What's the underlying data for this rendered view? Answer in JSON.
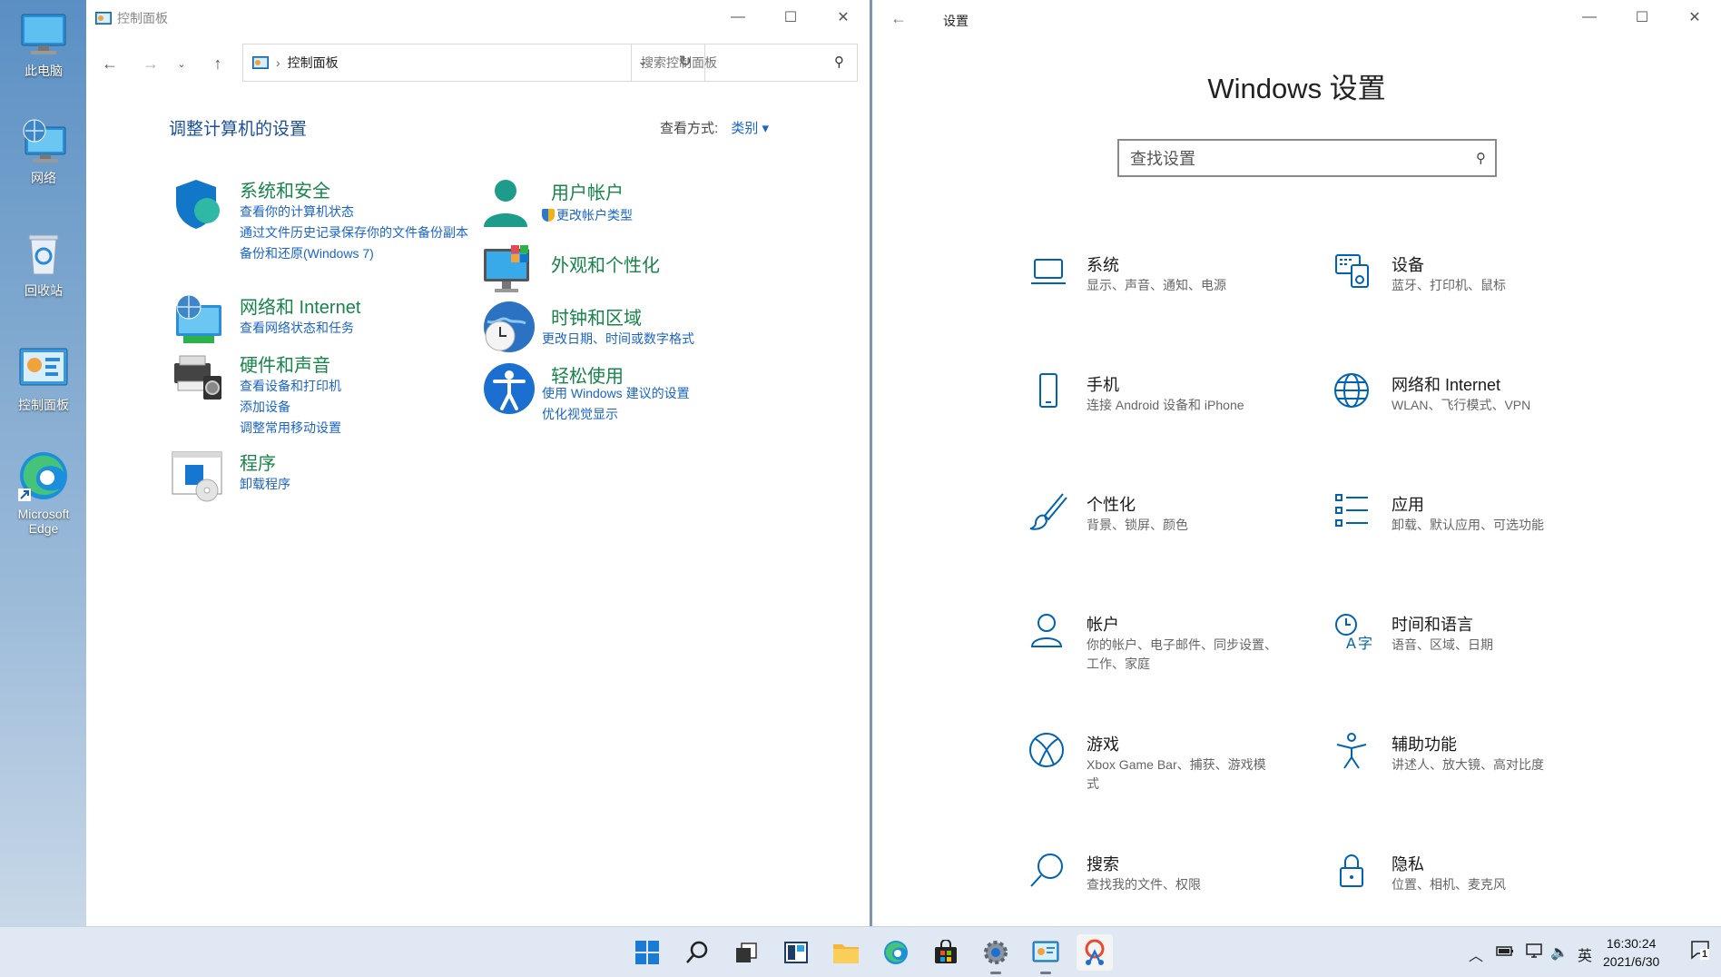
{
  "desktop": {
    "icons": [
      {
        "label": "此电脑"
      },
      {
        "label": "网络"
      },
      {
        "label": "回收站"
      },
      {
        "label": "控制面板"
      },
      {
        "label": "Microsoft Edge"
      }
    ]
  },
  "control_panel": {
    "window_title": "控制面板",
    "address": "控制面板",
    "search_placeholder": "搜索控制面板",
    "heading": "调整计算机的设置",
    "view_by_label": "查看方式:",
    "view_by_value": "类别 ▾",
    "categories": [
      {
        "title": "系统和安全",
        "links": [
          "查看你的计算机状态",
          "通过文件历史记录保存你的文件备份副本",
          "备份和还原(Windows 7)"
        ],
        "icon": "shield-icon"
      },
      {
        "title": "网络和 Internet",
        "links": [
          "查看网络状态和任务"
        ],
        "icon": "network-globe-icon"
      },
      {
        "title": "硬件和声音",
        "links": [
          "查看设备和打印机",
          "添加设备",
          "调整常用移动设置"
        ],
        "icon": "printer-icon"
      },
      {
        "title": "程序",
        "links": [
          "卸载程序"
        ],
        "icon": "programs-icon"
      },
      {
        "title": "用户帐户",
        "links": [
          "更改帐户类型"
        ],
        "icon": "user-icon"
      },
      {
        "title": "外观和个性化",
        "links": [],
        "icon": "monitor-color-icon"
      },
      {
        "title": "时钟和区域",
        "links": [
          "更改日期、时间或数字格式"
        ],
        "icon": "clock-globe-icon"
      },
      {
        "title": "轻松使用",
        "links": [
          "使用 Windows 建议的设置",
          "优化视觉显示"
        ],
        "icon": "accessibility-icon"
      }
    ]
  },
  "settings": {
    "window_title": "设置",
    "heading": "Windows 设置",
    "search_placeholder": "查找设置",
    "tiles": [
      {
        "title": "系统",
        "desc": "显示、声音、通知、电源",
        "icon": "laptop-icon"
      },
      {
        "title": "设备",
        "desc": "蓝牙、打印机、鼠标",
        "icon": "keyboard-speaker-icon"
      },
      {
        "title": "手机",
        "desc": "连接 Android 设备和 iPhone",
        "icon": "phone-icon"
      },
      {
        "title": "网络和 Internet",
        "desc": "WLAN、飞行模式、VPN",
        "icon": "globe-icon"
      },
      {
        "title": "个性化",
        "desc": "背景、锁屏、颜色",
        "icon": "brush-icon"
      },
      {
        "title": "应用",
        "desc": "卸载、默认应用、可选功能",
        "icon": "apps-list-icon"
      },
      {
        "title": "帐户",
        "desc": "你的帐户、电子邮件、同步设置、工作、家庭",
        "icon": "person-icon"
      },
      {
        "title": "时间和语言",
        "desc": "语音、区域、日期",
        "icon": "time-language-icon"
      },
      {
        "title": "游戏",
        "desc": "Xbox Game Bar、捕获、游戏模式",
        "icon": "xbox-icon"
      },
      {
        "title": "辅助功能",
        "desc": "讲述人、放大镜、高对比度",
        "icon": "accessibility-person-icon"
      },
      {
        "title": "搜索",
        "desc": "查找我的文件、权限",
        "icon": "search-icon"
      },
      {
        "title": "隐私",
        "desc": "位置、相机、麦克风",
        "icon": "lock-icon"
      }
    ]
  },
  "taskbar": {
    "ime": "英",
    "time": "16:30:24",
    "date": "2021/6/30",
    "notification_count": "1"
  },
  "colors": {
    "accent": "#0063b1",
    "cp_link": "#1a64c8",
    "cp_category": "#17854a",
    "cp_heading": "#1b4f9b"
  }
}
